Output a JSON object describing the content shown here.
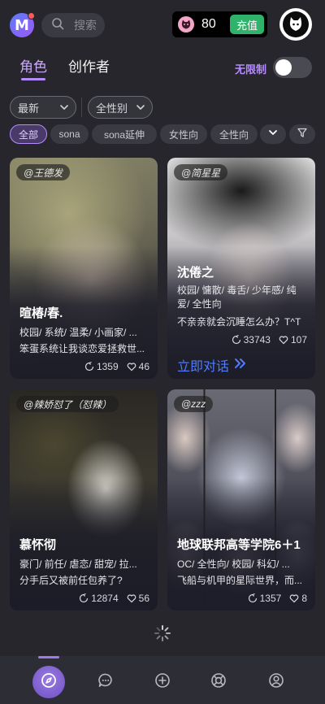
{
  "header": {
    "logo_letter": "M",
    "search_placeholder": "搜索",
    "coin_count": "80",
    "recharge_label": "充值"
  },
  "tabs": [
    {
      "label": "角色",
      "active": true
    },
    {
      "label": "创作者",
      "active": false
    }
  ],
  "unlimited_label": "无限制",
  "unlimited_on": false,
  "filters": {
    "sort": "最新",
    "gender": "全性别"
  },
  "chips": [
    {
      "label": "全部",
      "active": true
    },
    {
      "label": "sona",
      "active": false
    },
    {
      "label": "sona延伸",
      "active": false
    },
    {
      "label": "女性向",
      "active": false
    },
    {
      "label": "全性向",
      "active": false
    }
  ],
  "cards": [
    {
      "author": "@王德发",
      "name": "暄椿/春.",
      "tags": "校园/ 系统/ 温柔/ 小画家/ ...",
      "desc": "笨蛋系统让我谈恋爱拯救世...",
      "chats": "1359",
      "likes": "46"
    },
    {
      "author": "@简星星",
      "name": "沈倦之",
      "tags": "校园/ 慵散/ 毒舌/ 少年感/ 纯爱/ 全性向",
      "desc": "不亲亲就会沉睡怎么办？T^T",
      "chats": "33743",
      "likes": "107",
      "cta": "立即对话"
    },
    {
      "author": "@辣娇怼了（怼辣）",
      "name": "慕怀彻",
      "tags": "豪门/ 前任/ 虐恋/ 甜宠/ 拉...",
      "desc": "分手后又被前任包养了?",
      "chats": "12874",
      "likes": "56"
    },
    {
      "author": "@zzz",
      "name": "地球联邦高等学院6＋1",
      "tags": "OC/ 全性向/ 校园/ 科幻/ ...",
      "desc": "飞船与机甲的星际世界，而...",
      "chats": "1357",
      "likes": "8"
    }
  ],
  "bottom_nav": [
    {
      "icon": "compass-icon",
      "active": true
    },
    {
      "icon": "chat-bubble-icon",
      "active": false
    },
    {
      "icon": "plus-circle-icon",
      "active": false
    },
    {
      "icon": "lifebuoy-icon",
      "active": false
    },
    {
      "icon": "user-icon",
      "active": false
    }
  ],
  "colors": {
    "accent": "#b48cff",
    "recharge": "#2fb36a",
    "link": "#4f7cff",
    "background": "#26262c"
  }
}
